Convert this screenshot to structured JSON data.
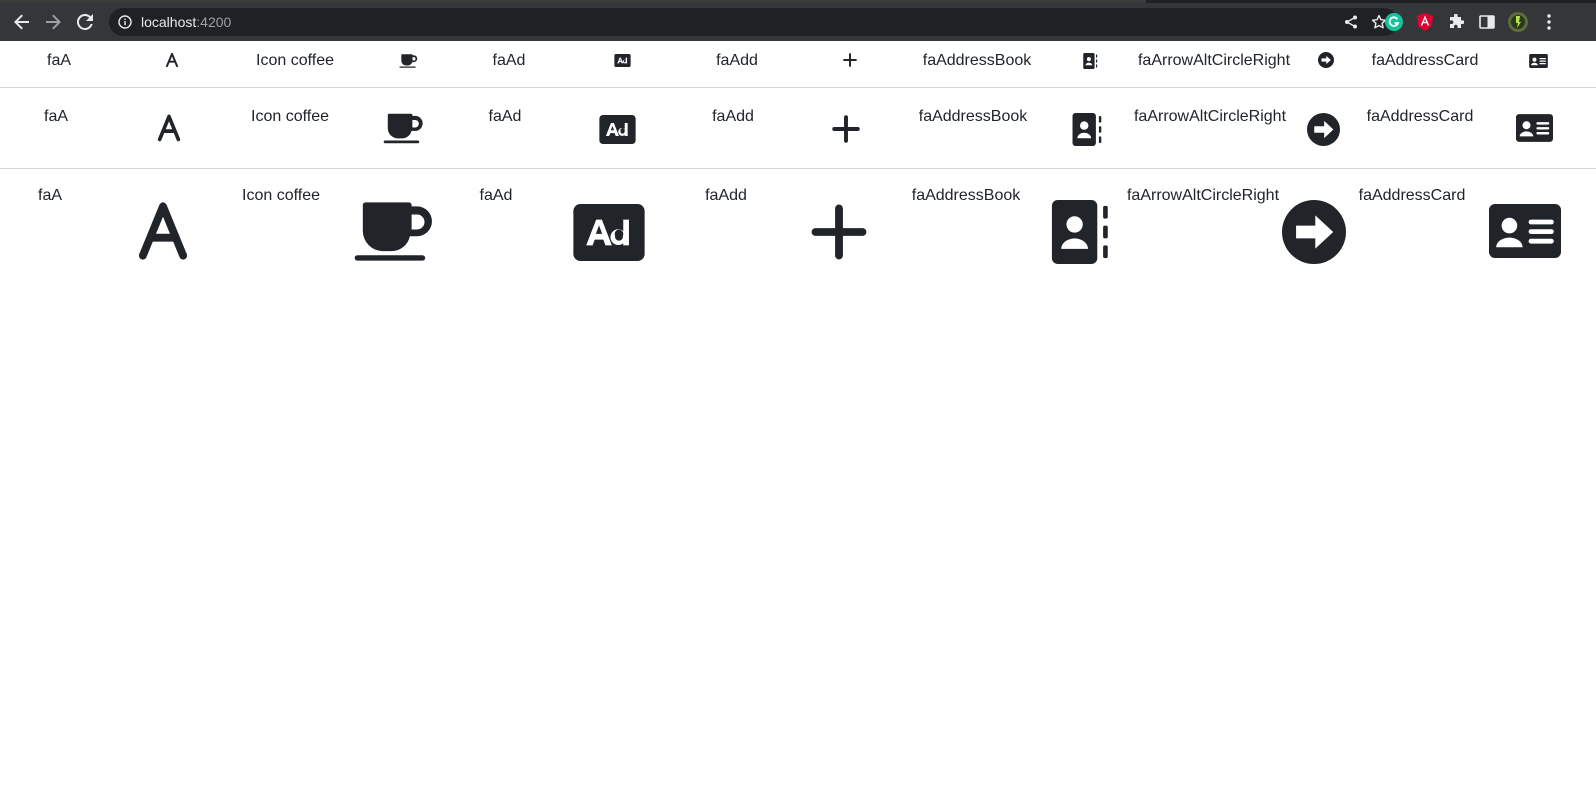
{
  "browser": {
    "url_host": "localhost",
    "url_port": ":4200",
    "colors": {
      "chrome_bg": "#35363a",
      "omnibox_bg": "#202124",
      "text": "#e8eaed",
      "muted": "#9aa0a6"
    },
    "icons": [
      "back-arrow-icon",
      "forward-arrow-icon",
      "reload-icon",
      "info-icon",
      "share-icon",
      "star-icon",
      "grammarly-icon",
      "angular-icon",
      "puzzle-icon",
      "side-panel-icon",
      "profile-avatar-icon",
      "kebab-menu-icon"
    ]
  },
  "rows": [
    {
      "name": "row-small",
      "items": [
        {
          "label": "faA",
          "icon": "letter-a-icon"
        },
        {
          "label": "Icon coffee",
          "icon": "coffee-icon"
        },
        {
          "label": "faAd",
          "icon": "ad-icon"
        },
        {
          "label": "faAdd",
          "icon": "plus-icon"
        },
        {
          "label": "faAddressBook",
          "icon": "address-book-icon"
        },
        {
          "label": "faArrowAltCircleRight",
          "icon": "arrow-circle-right-icon"
        },
        {
          "label": "faAddressCard",
          "icon": "address-card-icon"
        }
      ]
    },
    {
      "name": "row-medium",
      "items": [
        {
          "label": "faA",
          "icon": "letter-a-icon"
        },
        {
          "label": "Icon coffee",
          "icon": "coffee-icon"
        },
        {
          "label": "faAd",
          "icon": "ad-icon"
        },
        {
          "label": "faAdd",
          "icon": "plus-icon"
        },
        {
          "label": "faAddressBook",
          "icon": "address-book-icon"
        },
        {
          "label": "faArrowAltCircleRight",
          "icon": "arrow-circle-right-icon"
        },
        {
          "label": "faAddressCard",
          "icon": "address-card-icon"
        }
      ]
    },
    {
      "name": "row-large",
      "items": [
        {
          "label": "faA",
          "icon": "letter-a-icon"
        },
        {
          "label": "Icon coffee",
          "icon": "coffee-icon"
        },
        {
          "label": "faAd",
          "icon": "ad-icon"
        },
        {
          "label": "faAdd",
          "icon": "plus-icon"
        },
        {
          "label": "faAddressBook",
          "icon": "address-book-icon"
        },
        {
          "label": "faArrowAltCircleRight",
          "icon": "arrow-circle-right-icon"
        },
        {
          "label": "faAddressCard",
          "icon": "address-card-icon"
        }
      ]
    }
  ],
  "colors": {
    "icon": "#212529",
    "text": "#212529",
    "divider": "#d6d6d6"
  }
}
